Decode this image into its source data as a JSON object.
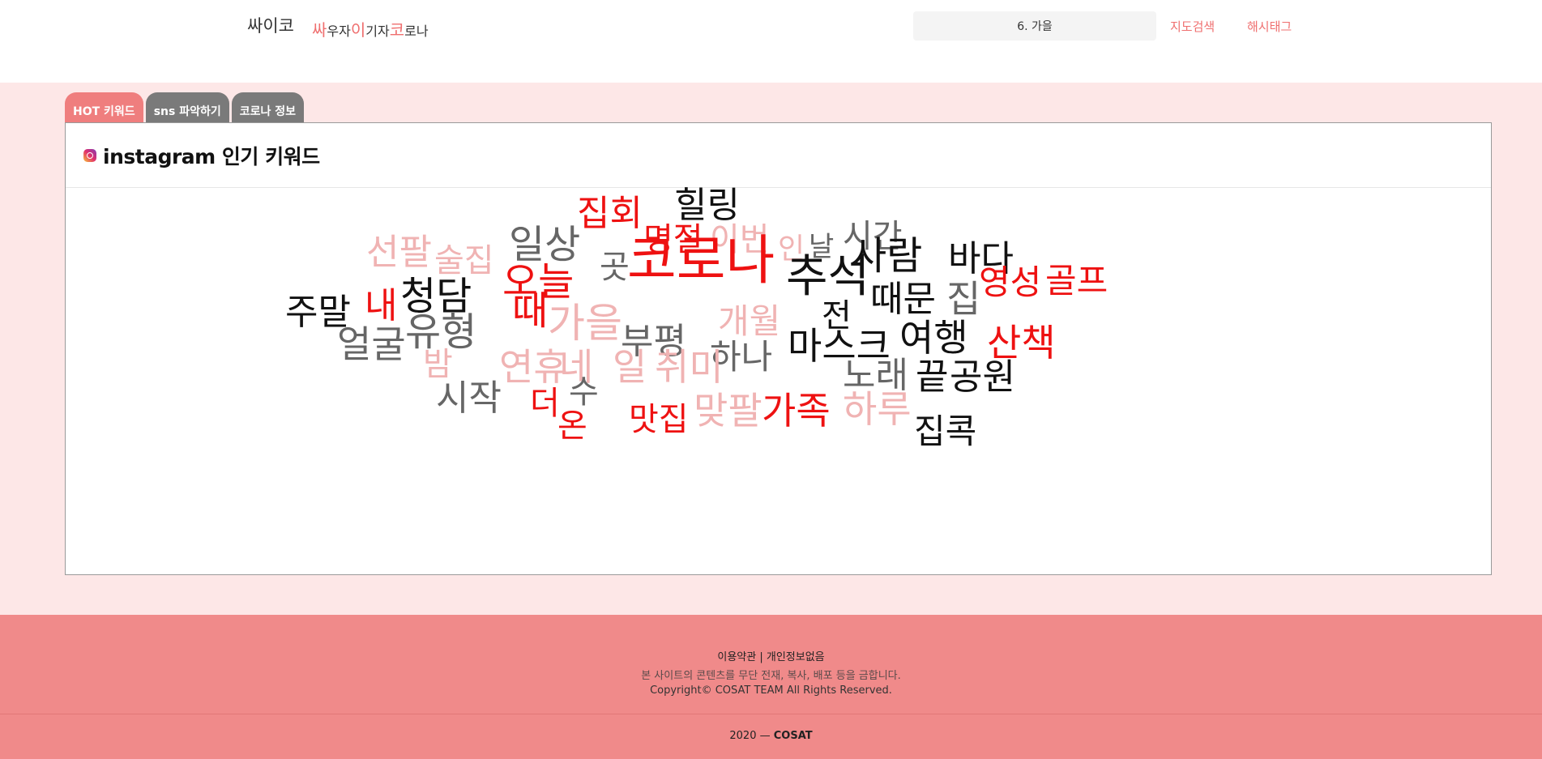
{
  "header": {
    "brand": "싸이코",
    "tagline": [
      {
        "text": "싸",
        "highlight": true
      },
      {
        "text": "우자 ",
        "highlight": false
      },
      {
        "text": "이",
        "highlight": true
      },
      {
        "text": "기자 ",
        "highlight": false
      },
      {
        "text": "코",
        "highlight": true
      },
      {
        "text": "로나",
        "highlight": false
      }
    ],
    "search_value": "6. 가을",
    "nav": [
      "지도검색",
      "해시태그"
    ]
  },
  "tabs": [
    {
      "label": "HOT 키워드",
      "active": true
    },
    {
      "label": "sns 파악하기",
      "active": false
    },
    {
      "label": "코로나 정보",
      "active": false
    }
  ],
  "panel": {
    "title": "instagram 인기 키워드",
    "icon": "instagram-icon"
  },
  "colors": {
    "accent": "#ef6f6f",
    "red": "#ee1111",
    "pink": "#f0b3b3",
    "gray": "#666666",
    "black": "#111111"
  },
  "word_cloud": [
    {
      "text": "힐링",
      "color": "black"
    },
    {
      "text": "집회",
      "color": "red"
    },
    {
      "text": "명절",
      "color": "red"
    },
    {
      "text": "이번",
      "color": "pink"
    },
    {
      "text": "인",
      "color": "pink"
    },
    {
      "text": "날",
      "color": "gray"
    },
    {
      "text": "시간",
      "color": "gray"
    },
    {
      "text": "선팔",
      "color": "pink"
    },
    {
      "text": "술집",
      "color": "pink"
    },
    {
      "text": "일상",
      "color": "gray"
    },
    {
      "text": "곳",
      "color": "gray"
    },
    {
      "text": "사람",
      "color": "black"
    },
    {
      "text": "바다",
      "color": "black"
    },
    {
      "text": "오늘",
      "color": "red"
    },
    {
      "text": "코로나",
      "color": "red"
    },
    {
      "text": "추석",
      "color": "black"
    },
    {
      "text": "영성",
      "color": "red"
    },
    {
      "text": "골프",
      "color": "red"
    },
    {
      "text": "주말",
      "color": "black"
    },
    {
      "text": "내",
      "color": "red"
    },
    {
      "text": "청담",
      "color": "black"
    },
    {
      "text": "때",
      "color": "red"
    },
    {
      "text": "전",
      "color": "black"
    },
    {
      "text": "때문",
      "color": "black"
    },
    {
      "text": "집",
      "color": "gray"
    },
    {
      "text": "가을",
      "color": "pink"
    },
    {
      "text": "부평",
      "color": "gray"
    },
    {
      "text": "개월",
      "color": "pink"
    },
    {
      "text": "얼굴",
      "color": "gray"
    },
    {
      "text": "유형",
      "color": "gray"
    },
    {
      "text": "하나",
      "color": "gray"
    },
    {
      "text": "마스크",
      "color": "black"
    },
    {
      "text": "여행",
      "color": "black"
    },
    {
      "text": "산책",
      "color": "red"
    },
    {
      "text": "밤",
      "color": "pink"
    },
    {
      "text": "연휴",
      "color": "pink"
    },
    {
      "text": "네",
      "color": "pink"
    },
    {
      "text": "일",
      "color": "pink"
    },
    {
      "text": "취미",
      "color": "pink"
    },
    {
      "text": "노래",
      "color": "gray"
    },
    {
      "text": "끝",
      "color": "black"
    },
    {
      "text": "공원",
      "color": "black"
    },
    {
      "text": "시작",
      "color": "gray"
    },
    {
      "text": "수",
      "color": "gray"
    },
    {
      "text": "더",
      "color": "red"
    },
    {
      "text": "온",
      "color": "red"
    },
    {
      "text": "맛집",
      "color": "red"
    },
    {
      "text": "맞팔",
      "color": "pink"
    },
    {
      "text": "가족",
      "color": "red"
    },
    {
      "text": "하루",
      "color": "pink"
    },
    {
      "text": "집콕",
      "color": "black"
    }
  ],
  "footer": {
    "links": "이용약관 | 개인정보없음",
    "notice": "본 사이트의 콘텐츠를 무단 전재, 복사, 배포 등을 금합니다.",
    "copyright": "Copyright© COSAT TEAM All Rights Reserved.",
    "year": "2020 — ",
    "team": "COSAT"
  }
}
